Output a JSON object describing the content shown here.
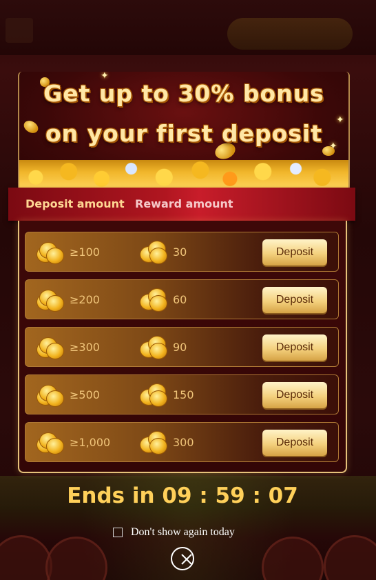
{
  "banner": {
    "line1": "Get up to 30% bonus",
    "line2": "on your first deposit"
  },
  "table": {
    "col_deposit": "Deposit amount",
    "col_reward": "Reward amount",
    "rows": [
      {
        "amount": "≥100",
        "reward": "30",
        "button": "Deposit"
      },
      {
        "amount": "≥200",
        "reward": "60",
        "button": "Deposit"
      },
      {
        "amount": "≥300",
        "reward": "90",
        "button": "Deposit"
      },
      {
        "amount": "≥500",
        "reward": "150",
        "button": "Deposit"
      },
      {
        "amount": "≥1,000",
        "reward": "300",
        "button": "Deposit"
      }
    ]
  },
  "timer": {
    "text": "Ends in 09 : 59 : 07"
  },
  "dont_show": {
    "label": "Don't show again today",
    "checked": false
  },
  "colors": {
    "accent_gold": "#ffd05a",
    "header_red": "#b01620",
    "button_gold": "#f4d17e"
  },
  "icons": {
    "coin": "coin-stack-icon",
    "close": "close-icon"
  }
}
